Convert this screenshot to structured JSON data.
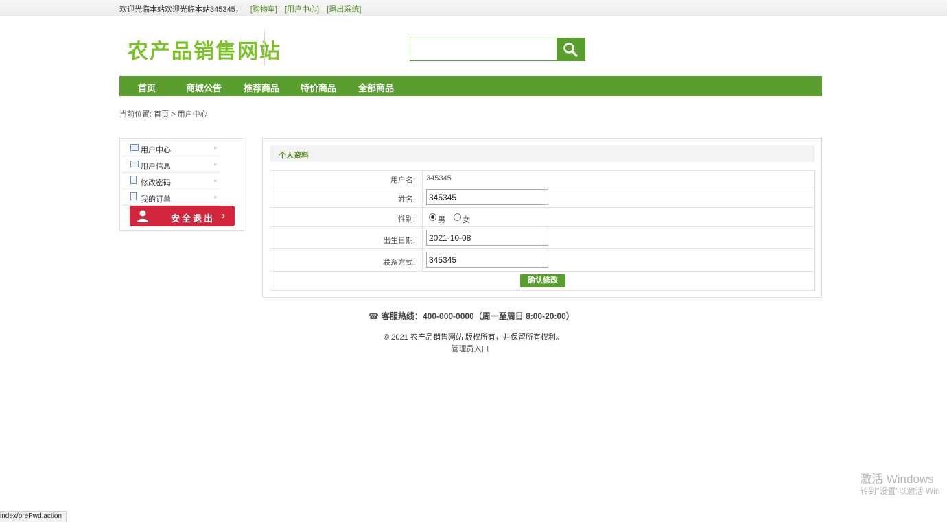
{
  "topbar": {
    "welcome": "欢迎光临本站欢迎光临本站345345，",
    "cart": "[购物车]",
    "user_center": "[用户中心]",
    "logout": "[退出系统]"
  },
  "logo_text": "农产品销售网站",
  "search": {
    "placeholder": "",
    "icon": "search-icon"
  },
  "nav": [
    "首页",
    "商城公告",
    "推荐商品",
    "特价商品",
    "全部商品"
  ],
  "breadcrumb": "当前位置: 首页 > 用户中心",
  "sidebar": {
    "items": [
      {
        "label": "用户中心",
        "icon": "user-card-icon"
      },
      {
        "label": "用户信息",
        "icon": "user-card-icon"
      },
      {
        "label": "修改密码",
        "icon": "document-icon"
      },
      {
        "label": "我的订单",
        "icon": "document-icon"
      }
    ],
    "arrow": "»",
    "logout_button": "安全退出",
    "logout_arrow": "›"
  },
  "profile": {
    "title": "个人资料",
    "username_label": "用户名:",
    "username": "345345",
    "name_label": "姓名:",
    "name": "345345",
    "gender_label": "性别:",
    "gender_options": [
      "男",
      "女"
    ],
    "gender_selected": "男",
    "birth_label": "出生日期:",
    "birth": "2021-10-08",
    "contact_label": "联系方式:",
    "contact": "345345",
    "submit": "确认修改"
  },
  "footer": {
    "hotline": "客服热线：400-000-0000（周一至周日 8:00-20:00）",
    "copyright": "© 2021 农产品销售网站 版权所有，并保留所有权利。",
    "admin": "管理员入口"
  },
  "watermark": {
    "line1": "激活 Windows",
    "line2": "转到\"设置\"以激活 Win"
  },
  "status_url": "index/prePwd.action",
  "colors": {
    "primary_green": "#5a9e2f",
    "logo_green": "#7cc02a",
    "logout_red": "#d1263b"
  }
}
